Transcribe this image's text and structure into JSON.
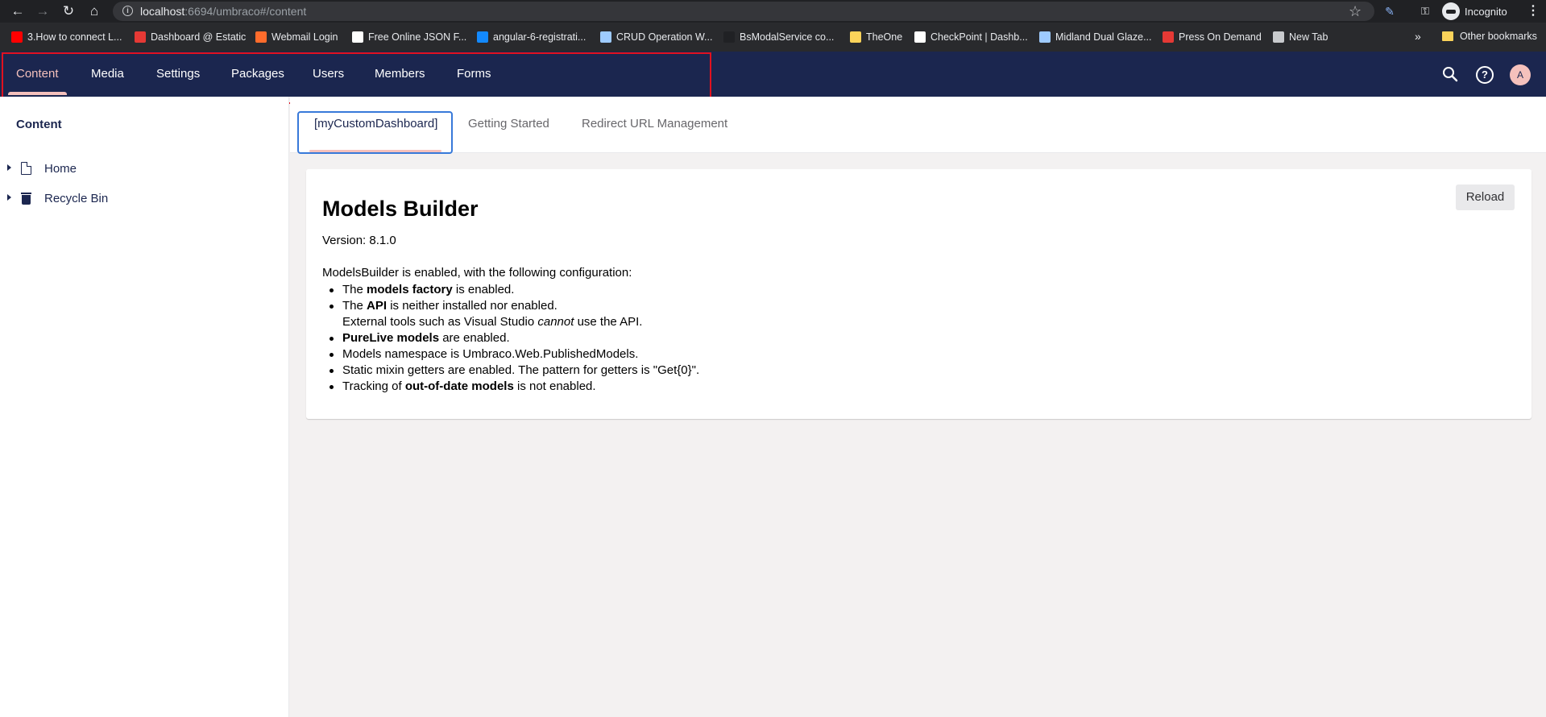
{
  "browser": {
    "url_host": "localhost",
    "url_rest": ":6694/umbraco#/content",
    "incognito_label": "Incognito",
    "bookmarks": [
      {
        "label": "3.How to connect L...",
        "icon": "youtube-icon",
        "color": "#ff0000"
      },
      {
        "label": "Dashboard @ Estatic",
        "icon": "estatic-icon",
        "color": "#e53935"
      },
      {
        "label": "Webmail Login",
        "icon": "cpanel-icon",
        "color": "#ff6c2c"
      },
      {
        "label": "Free Online JSON F...",
        "icon": "ff-icon",
        "color": "#ffffff"
      },
      {
        "label": "angular-6-registrati...",
        "icon": "stackblitz-icon",
        "color": "#1389fd"
      },
      {
        "label": "CRUD Operation W...",
        "icon": "crud-icon",
        "color": "#9ecbff"
      },
      {
        "label": "BsModalService co...",
        "icon": "github-icon",
        "color": "#202124"
      },
      {
        "label": "TheOne",
        "icon": "note-icon",
        "color": "#fbd35a"
      },
      {
        "label": "CheckPoint | Dashb...",
        "icon": "checkpoint-icon",
        "color": "#ffffff"
      },
      {
        "label": "Midland Dual Glaze...",
        "icon": "document-icon",
        "color": "#9ecbff"
      },
      {
        "label": "Press On Demand",
        "icon": "estatic-icon",
        "color": "#e53935"
      },
      {
        "label": "New Tab",
        "icon": "globe-icon",
        "color": "#c8cacd"
      }
    ],
    "bookmarks_more": "»",
    "other_bookmarks": "Other bookmarks"
  },
  "header": {
    "sections": [
      "Content",
      "Media",
      "Settings",
      "Packages",
      "Users",
      "Members",
      "Forms"
    ],
    "active_section": "Content",
    "user_initial": "A"
  },
  "tree": {
    "title": "Content",
    "items": [
      {
        "label": "Home",
        "icon": "document-icon"
      },
      {
        "label": "Recycle Bin",
        "icon": "trash-icon"
      }
    ]
  },
  "dashboard": {
    "tabs": [
      "[myCustomDashboard]",
      "Getting Started",
      "Redirect URL Management"
    ],
    "active_tab": "[myCustomDashboard]"
  },
  "panel": {
    "title": "Models Builder",
    "reload_label": "Reload",
    "version": "Version: 8.1.0",
    "intro": "ModelsBuilder is enabled, with the following configuration:",
    "items": [
      {
        "pre": "The ",
        "bold": "models factory",
        "post": " is enabled."
      },
      {
        "pre": "The ",
        "bold": "API",
        "post": " is neither installed nor enabled."
      },
      {
        "pre": "External tools such as Visual Studio ",
        "italic": "cannot",
        "post": " use the API."
      },
      {
        "pre": "",
        "bold": "PureLive models",
        "post": " are enabled."
      },
      {
        "text": "Models namespace is Umbraco.Web.PublishedModels."
      },
      {
        "text": "Static mixin getters are enabled. The pattern for getters is \"Get{0}\"."
      },
      {
        "pre": "Tracking of ",
        "bold": "out-of-date models",
        "post": " is not enabled."
      }
    ]
  },
  "colors": {
    "header_bg": "#1b264f",
    "accent_pink": "#f5c1bc",
    "highlight_red": "#e1111f",
    "tab_border_blue": "#3879d9"
  }
}
